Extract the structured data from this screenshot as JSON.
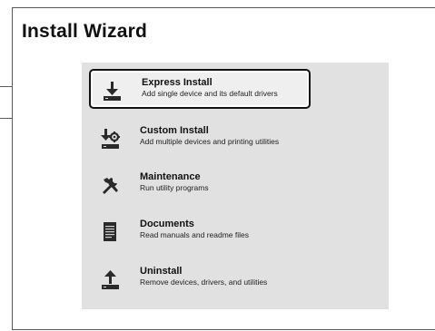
{
  "window": {
    "title": "Install Wizard"
  },
  "options": [
    {
      "label": "Express Install",
      "description": "Add single device and its default drivers",
      "icon": "download-install-icon",
      "selected": true
    },
    {
      "label": "Custom Install",
      "description": "Add multiple devices and printing utilities",
      "icon": "custom-install-gear-icon",
      "selected": false
    },
    {
      "label": "Maintenance",
      "description": "Run utility programs",
      "icon": "tools-wrench-icon",
      "selected": false
    },
    {
      "label": "Documents",
      "description": "Read manuals and readme files",
      "icon": "document-icon",
      "selected": false
    },
    {
      "label": "Uninstall",
      "description": "Remove devices, drivers, and utilities",
      "icon": "upload-uninstall-icon",
      "selected": false
    }
  ]
}
